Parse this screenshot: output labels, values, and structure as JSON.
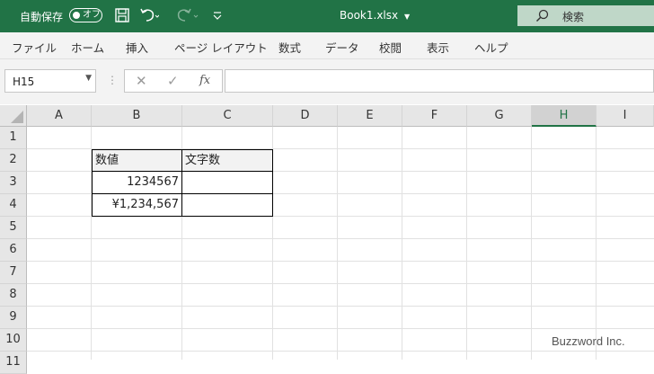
{
  "titlebar": {
    "autosave_label": "自動保存",
    "autosave_state": "オフ",
    "filename": "Book1.xlsx",
    "search_placeholder": "検索",
    "accent": "#217346"
  },
  "menu": [
    "ファイル",
    "ホーム",
    "挿入",
    "ページ レイアウト",
    "数式",
    "データ",
    "校閲",
    "表示",
    "ヘルプ"
  ],
  "formula_bar": {
    "name_box": "H15",
    "fx_label": "fx",
    "formula": ""
  },
  "grid": {
    "columns": [
      "A",
      "B",
      "C",
      "D",
      "E",
      "F",
      "G",
      "H",
      "I"
    ],
    "selected_column": "H",
    "rows": [
      "1",
      "2",
      "3",
      "4",
      "5",
      "6",
      "7",
      "8",
      "9",
      "10",
      "11"
    ],
    "cells": {
      "B2": "数値",
      "C2": "文字数",
      "B3": "1234567",
      "B4": "¥1,234,567"
    }
  },
  "watermark": "Buzzword Inc."
}
